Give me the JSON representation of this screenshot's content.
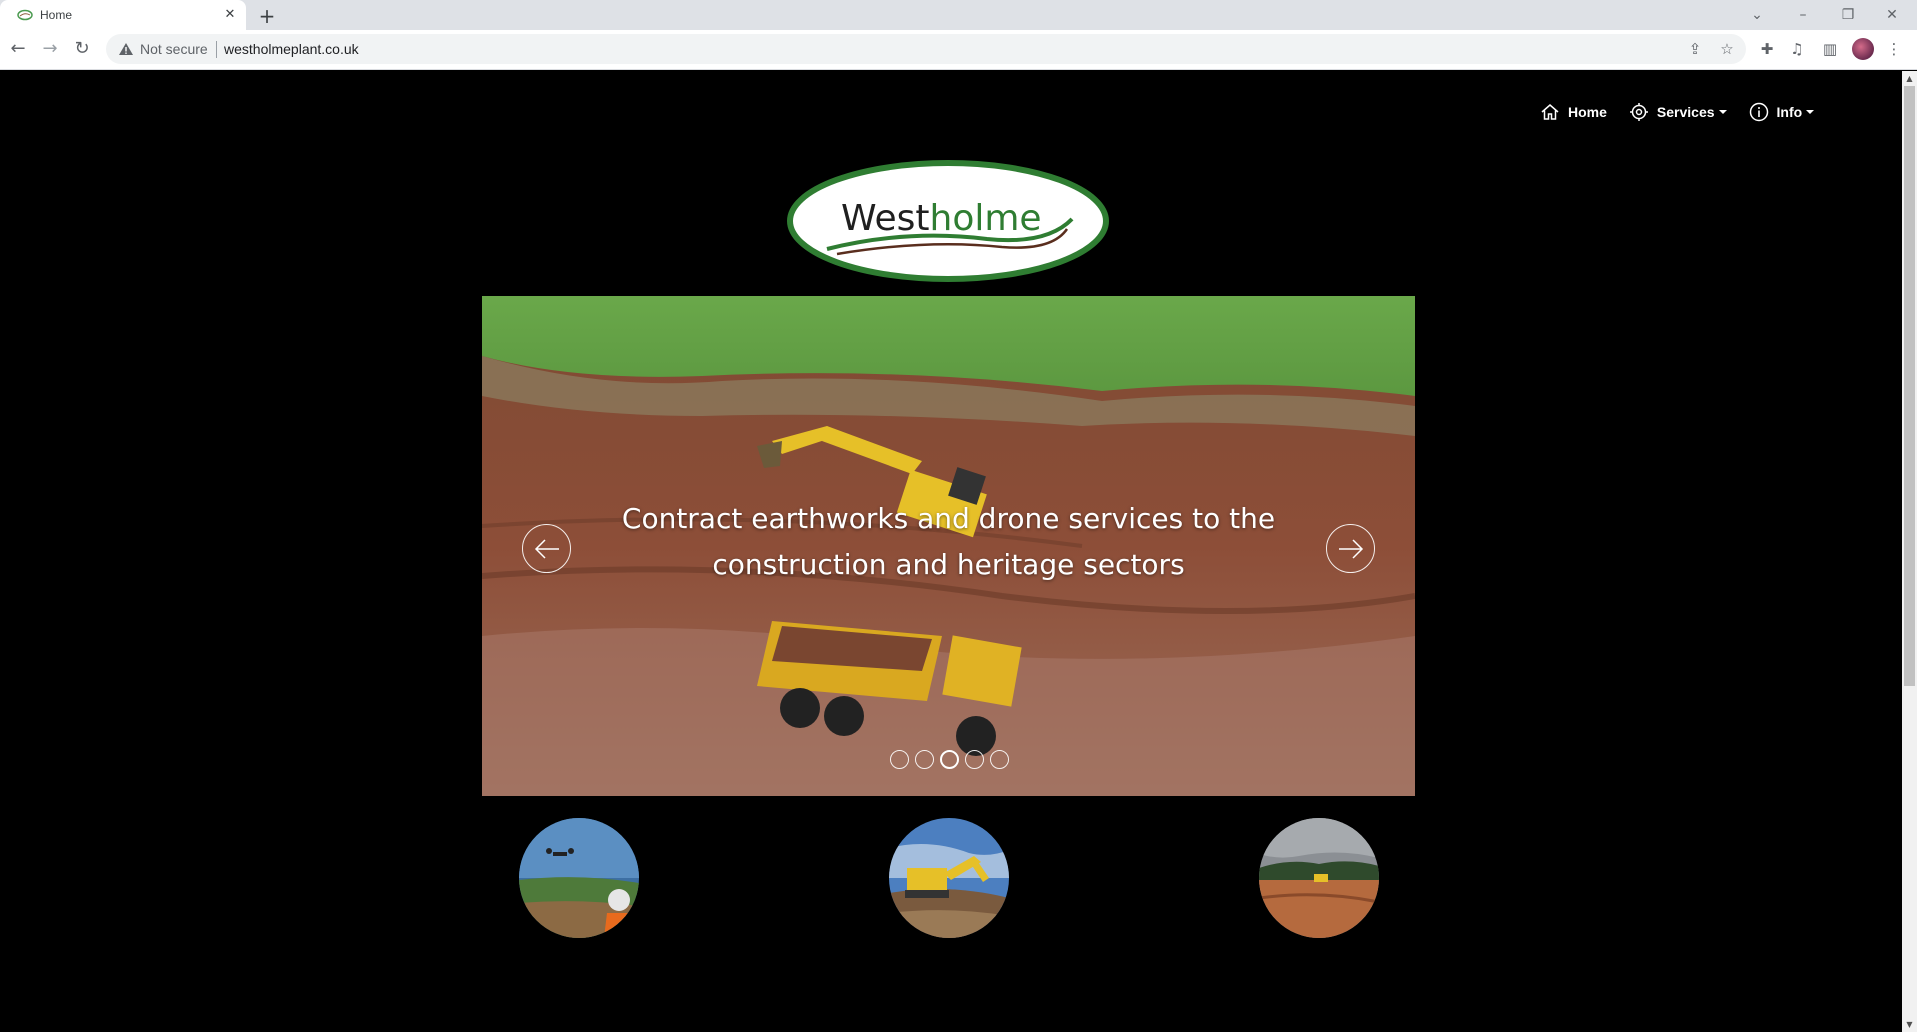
{
  "browser": {
    "tab_title": "Home",
    "security_label": "Not secure",
    "url": "westholmeplant.co.uk",
    "icons": {
      "tab_close": "close-icon",
      "new_tab": "plus-icon",
      "back": "back-arrow-icon",
      "forward": "forward-arrow-icon",
      "reload": "reload-icon",
      "warning": "warning-icon",
      "share": "share-icon",
      "bookmark": "star-icon",
      "extensions": "puzzle-icon",
      "media": "media-queue-icon",
      "side_panel": "side-panel-icon",
      "menu": "kebab-menu-icon"
    }
  },
  "site": {
    "nav": [
      {
        "label": "Home",
        "icon": "home-icon",
        "dropdown": false
      },
      {
        "label": "Services",
        "icon": "target-icon",
        "dropdown": true
      },
      {
        "label": "Info",
        "icon": "info-icon",
        "dropdown": true
      }
    ],
    "logo_text": "Westholme",
    "slider": {
      "caption_line1": "Contract earthworks and drone services to the",
      "caption_line2": "construction and heritage sectors",
      "slide_count": 5,
      "active_slide": 3
    },
    "colors": {
      "logo_green": "#2f7d32",
      "logo_text": "#1f1f1f",
      "page_bg": "#000000"
    }
  }
}
